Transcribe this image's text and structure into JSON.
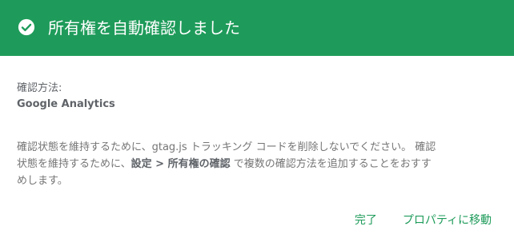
{
  "header": {
    "title": "所有権を自動確認しました",
    "icon": "check-circle-icon",
    "background": "#1e9b5a"
  },
  "method": {
    "label": "確認方法:",
    "value": "Google Analytics"
  },
  "message": {
    "line1": "確認状態を維持するために、gtag.js トラッキング コードを削除しないでください。 確認",
    "line2_pre": "状態を維持するために、",
    "line2_bold": "設定 > 所有権の確認",
    "line2_post": " で複数の確認方法を追加することをおすす",
    "line3": "めします。"
  },
  "actions": {
    "done_label": "完了",
    "go_to_property_label": "プロパティに移動"
  }
}
